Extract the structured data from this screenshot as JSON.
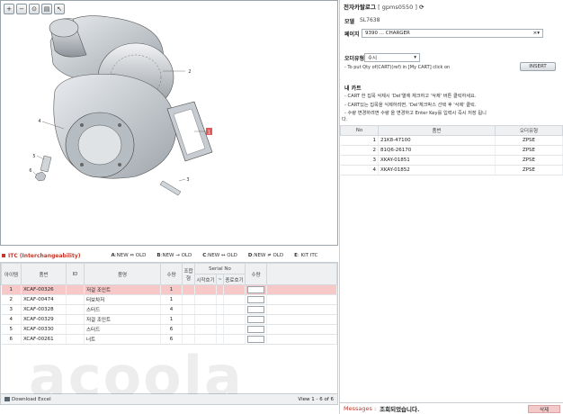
{
  "viewer": {
    "tools": [
      "zoom-in-icon",
      "zoom-out-icon",
      "zoom-fit-icon",
      "print-icon",
      "pointer-icon"
    ],
    "callouts": [
      {
        "label": "1"
      },
      {
        "label": "2"
      },
      {
        "label": "3"
      },
      {
        "label": "4"
      },
      {
        "label": "5"
      },
      {
        "label": "6"
      }
    ]
  },
  "itc": {
    "title": "ITC (Interchangeability)",
    "legend": [
      {
        "key": "A",
        "text": ":NEW ⇔ OLD"
      },
      {
        "key": "B",
        "text": ":NEW → OLD"
      },
      {
        "key": "C",
        "text": ":NEW ↔ OLD"
      },
      {
        "key": "D",
        "text": ":NEW ≠ OLD"
      },
      {
        "key": "E",
        "text": ": KIT ITC"
      }
    ],
    "headers": {
      "item": "아이템",
      "part_no": "품번",
      "itc": "ID",
      "part_name": "품명",
      "qty": "수량",
      "combo": "조합형",
      "serial": "Serial No",
      "serial_start": "시작호기",
      "serial_sep": "~",
      "serial_end": "종료호기",
      "order_qty": "수량"
    },
    "rows": [
      {
        "item": "1",
        "part_no": "XCAF-00326",
        "part_name": "저걸 조인트",
        "qty": "1"
      },
      {
        "item": "2",
        "part_no": "XCAF-00474",
        "part_name": "터보차저",
        "qty": "1"
      },
      {
        "item": "3",
        "part_no": "XCAF-00328",
        "part_name": "스터드",
        "qty": "4"
      },
      {
        "item": "4",
        "part_no": "XCAF-00329",
        "part_name": "저걸 조인트",
        "qty": "1"
      },
      {
        "item": "5",
        "part_no": "XCAF-00330",
        "part_name": "스터드",
        "qty": "6"
      },
      {
        "item": "6",
        "part_no": "XCAF-00261",
        "part_name": "너트",
        "qty": "6"
      }
    ],
    "footer": {
      "download": "Download Excel",
      "view": "View 1 - 6 of 6"
    }
  },
  "right": {
    "title": "전자카탈로그",
    "subtitle": "[ gpms0550 ]",
    "model_label": "모델",
    "model_value": "SL7638",
    "page_label": "페이지",
    "page_value": "9390 ... CHARGER",
    "order_label": "오더유형",
    "order_value": "수시",
    "cart_hint": "- To put Qty of(CART)(ref) in [My CART] click on",
    "insert_label": "INSERT",
    "my_cart_label": "내 카트",
    "notes": [
      "- CART 한 집목 삭제시 'Del'열에 체크하고 '삭제' 버튼 클릭하세요.",
      "- CART있는 집목을 식제하려면, 'Del'체크박스 선택 후 '삭제' 클릭.",
      "- 수량 변경하려면 수량 을 변경하고 Enter Key를 입력시 즉시 저장 됩니",
      "다."
    ],
    "cart_headers": {
      "no": "No",
      "part_no": "품번",
      "order_type": "오더유형"
    },
    "cart_rows": [
      {
        "no": "1",
        "part_no": "21K8-47100",
        "order_type": "ZPSE"
      },
      {
        "no": "2",
        "part_no": "81Q6-26170",
        "order_type": "ZPSE"
      },
      {
        "no": "3",
        "part_no": "XKAY-01851",
        "order_type": "ZPSE"
      },
      {
        "no": "4",
        "part_no": "XKAY-01852",
        "order_type": "ZPSE"
      }
    ],
    "messages_label": "Messages :",
    "message_text": "조회되었습니다.",
    "delete_label": "삭제"
  },
  "watermark": "acoola",
  "colors": {
    "accent_red": "#c0392b",
    "selected_row": "#f7c8c8",
    "header_bg": "#eef0f2"
  }
}
